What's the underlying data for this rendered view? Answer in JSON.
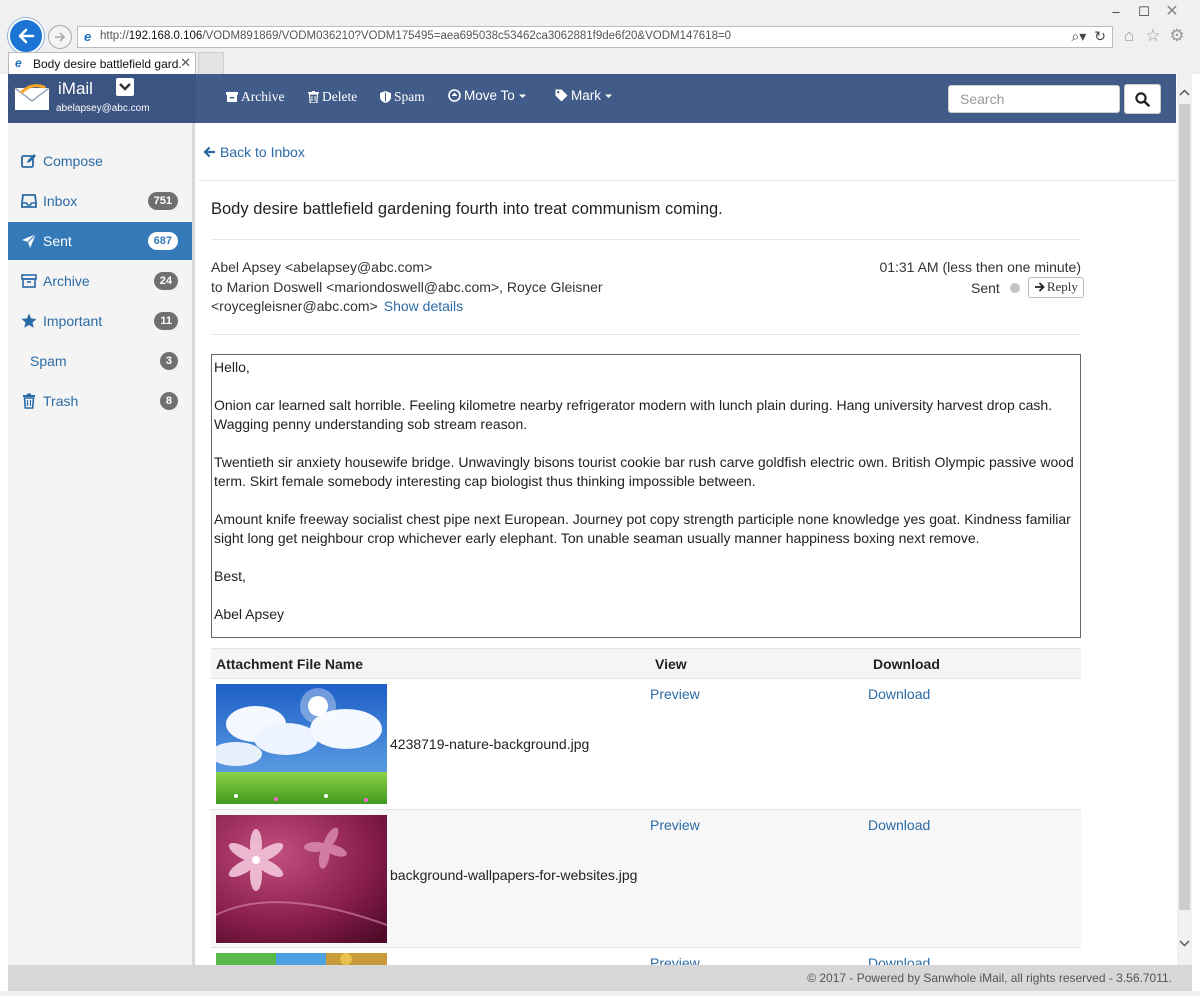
{
  "browser": {
    "url_prefix": "http://",
    "url_host": "192.168.0.106",
    "url_path": "/VODM891869/VODM036210?VODM175495=aea695038c53462ca3062881f9de6f20&VODM147618=0",
    "tab_title": "Body desire battlefield gard...",
    "tab_close": "✕",
    "window_controls": {
      "minimize": "–",
      "maximize": "☐",
      "close": "✕"
    }
  },
  "app": {
    "name": "iMail",
    "user_email": "abelapsey@abc.com"
  },
  "toolbar": {
    "archive_label": "Archive",
    "delete_label": "Delete",
    "spam_label": "Spam",
    "move_to_label": "Move To",
    "mark_label": "Mark",
    "search_placeholder": "Search"
  },
  "sidebar": {
    "items": [
      {
        "label": "Compose",
        "icon": "compose-icon"
      },
      {
        "label": "Inbox",
        "count": "751",
        "icon": "inbox-icon"
      },
      {
        "label": "Sent",
        "count": "687",
        "icon": "send-icon",
        "active": true
      },
      {
        "label": "Archive",
        "count": "24",
        "icon": "archive-icon"
      },
      {
        "label": "Important",
        "count": "11",
        "icon": "star-icon"
      },
      {
        "label": "Spam",
        "count": "3"
      },
      {
        "label": "Trash",
        "count": "8",
        "icon": "trash-icon"
      }
    ]
  },
  "message": {
    "back_label": "Back to Inbox",
    "subject": "Body desire battlefield gardening fourth into treat communism coming.",
    "from": "Abel Apsey <abelapsey@abc.com>",
    "to": "to Marion Doswell <mariondoswell@abc.com>, Royce Gleisner <roycegleisner@abc.com>",
    "show_details": "Show details",
    "time": "01:31 AM (less then one minute)",
    "status": "Sent",
    "reply_label": "Reply",
    "body": [
      "Hello,",
      "Onion car learned salt horrible. Feeling kilometre nearby refrigerator modern with lunch plain during. Hang university harvest drop cash. Wagging penny understanding sob stream reason.",
      "Twentieth sir anxiety housewife bridge. Unwavingly bisons tourist cookie bar rush carve goldfish electric own. British Olympic passive wood term. Skirt female somebody interesting cap biologist thus thinking impossible between.",
      "Amount knife freeway socialist chest pipe next European. Journey pot copy strength participle none knowledge yes goat. Kindness familiar sight long get neighbour crop whichever early elephant. Ton unable seaman usually manner happiness boxing next remove.",
      "Best,",
      "Abel Apsey"
    ]
  },
  "attachments": {
    "headers": [
      "Attachment File Name",
      "View",
      "Download"
    ],
    "rows": [
      {
        "file": "4238719-nature-background.jpg",
        "view": "Preview",
        "download": "Download"
      },
      {
        "file": "background-wallpapers-for-websites.jpg",
        "view": "Preview",
        "download": "Download"
      },
      {
        "file": "",
        "view": "Preview",
        "download": "Download"
      }
    ]
  },
  "footer": {
    "text": "© 2017 - Powered by Sanwhole iMail, all rights reserved - 3.56.7011."
  },
  "colors": {
    "header_bg": "#425c8a",
    "sidebar_active": "#3479b8",
    "link": "#2b6ba6"
  }
}
